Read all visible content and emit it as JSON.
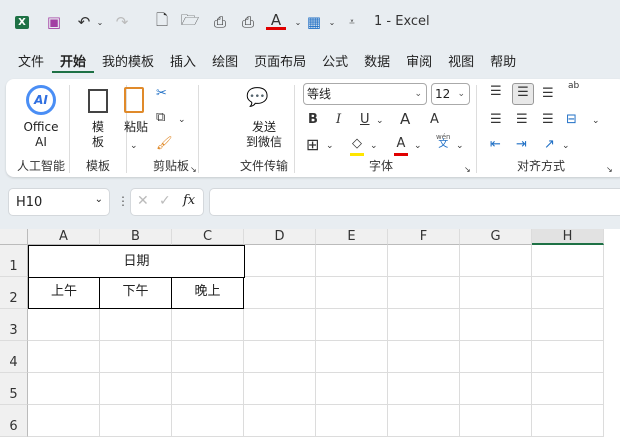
{
  "title_bar": {
    "title": "1  -  Excel"
  },
  "tabs": [
    "文件",
    "开始",
    "我的模板",
    "插入",
    "绘图",
    "页面布局",
    "公式",
    "数据",
    "审阅",
    "视图",
    "帮助"
  ],
  "active_tab": "开始",
  "ribbon": {
    "office_ai": {
      "label1": "Office",
      "label2": "AI",
      "icon_text": "AI",
      "group": "人工智能"
    },
    "template": {
      "label1": "模",
      "label2": "板",
      "group": "模板"
    },
    "clipboard": {
      "paste": "粘贴",
      "group": "剪贴板"
    },
    "transfer": {
      "label1": "发送",
      "label2": "到微信",
      "group": "文件传输"
    },
    "font": {
      "name": "等线",
      "size": "12",
      "bold": "B",
      "italic": "I",
      "underline": "U",
      "grow": "A",
      "shrink": "A",
      "font_color": "A",
      "phonetic_top": "wén",
      "phonetic_bottom": "文",
      "group": "字体",
      "font_color_hex": "#e00000",
      "fill_color_hex": "#ffe600"
    },
    "alignment": {
      "group": "对齐方式",
      "wrap": "ab"
    }
  },
  "formula_bar": {
    "name_box": "H10",
    "fx": "fx",
    "value": ""
  },
  "sheet": {
    "columns": [
      "A",
      "B",
      "C",
      "D",
      "E",
      "F",
      "G",
      "H"
    ],
    "selected_column": "H",
    "rows": [
      "1",
      "2",
      "3",
      "4",
      "5",
      "6"
    ],
    "cells": {
      "A1": "日期",
      "A2": "上午",
      "B2": "下午",
      "C2": "晚上"
    }
  }
}
